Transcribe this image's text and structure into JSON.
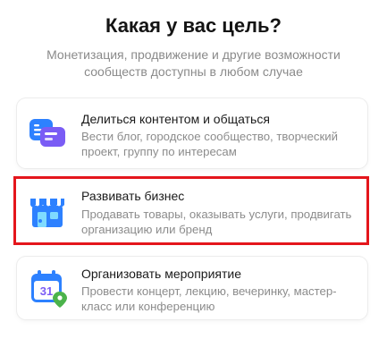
{
  "header": {
    "title": "Какая у вас цель?",
    "subtitle": "Монетизация, продвижение и другие возможности сообществ доступны в любом случае"
  },
  "options": [
    {
      "icon": "chat-bubbles-icon",
      "title": "Делиться контентом и общаться",
      "description": "Вести блог, городское сообщество, творческий проект, группу по интересам"
    },
    {
      "icon": "storefront-icon",
      "title": "Развивать бизнес",
      "description": "Продавать товары, оказывать услуги, продвигать организацию или бренд"
    },
    {
      "icon": "calendar-icon",
      "title": "Организовать мероприятие",
      "description": "Провести концерт, лекцию, вечеринку, мастер-класс или конференцию",
      "calendar_day": "31"
    }
  ],
  "selected_option": 1,
  "colors": {
    "highlight": "#e4161c",
    "icon_blue": "#2d81ff",
    "icon_purple": "#7a5cf5",
    "icon_green": "#4bb34b"
  }
}
